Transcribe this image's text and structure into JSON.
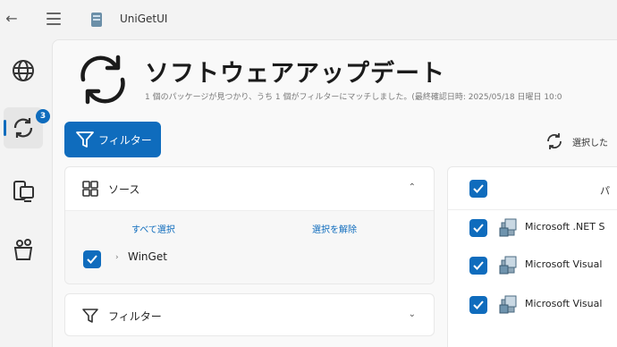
{
  "titlebar": {
    "title": "UniGetUI",
    "back_icon": "back-arrow-icon",
    "menu_icon": "hamburger-menu-icon"
  },
  "sidebar": {
    "items": [
      {
        "name": "discover",
        "icon": "globe-icon"
      },
      {
        "name": "updates",
        "icon": "sync-icon",
        "badge": "3",
        "active": true
      },
      {
        "name": "installed",
        "icon": "devices-icon"
      },
      {
        "name": "bundles",
        "icon": "package-bundle-icon"
      }
    ]
  },
  "header": {
    "title": "ソフトウェアアップデート",
    "subtitle": "1 個のパッケージが見つかり、うち 1 個がフィルターにマッチしました。(最終確認日時: 2025/05/18 日曜日 10:0",
    "icon": "sync-large-icon"
  },
  "toolbar": {
    "filter_label": "フィルター",
    "select_updates_label": "選択した"
  },
  "sources_panel": {
    "title": "ソース",
    "select_all": "すべて選択",
    "deselect": "選択を解除",
    "sources": [
      {
        "label": "WinGet",
        "checked": true
      }
    ]
  },
  "filters_panel": {
    "title": "フィルター"
  },
  "packages": {
    "header_label": "パ",
    "rows": [
      {
        "name": "Microsoft .NET S",
        "checked": true
      },
      {
        "name": "Microsoft Visual",
        "checked": true
      },
      {
        "name": "Microsoft Visual",
        "checked": true
      }
    ]
  },
  "colors": {
    "accent": "#0f6cbd",
    "background": "#f3f3f3"
  }
}
